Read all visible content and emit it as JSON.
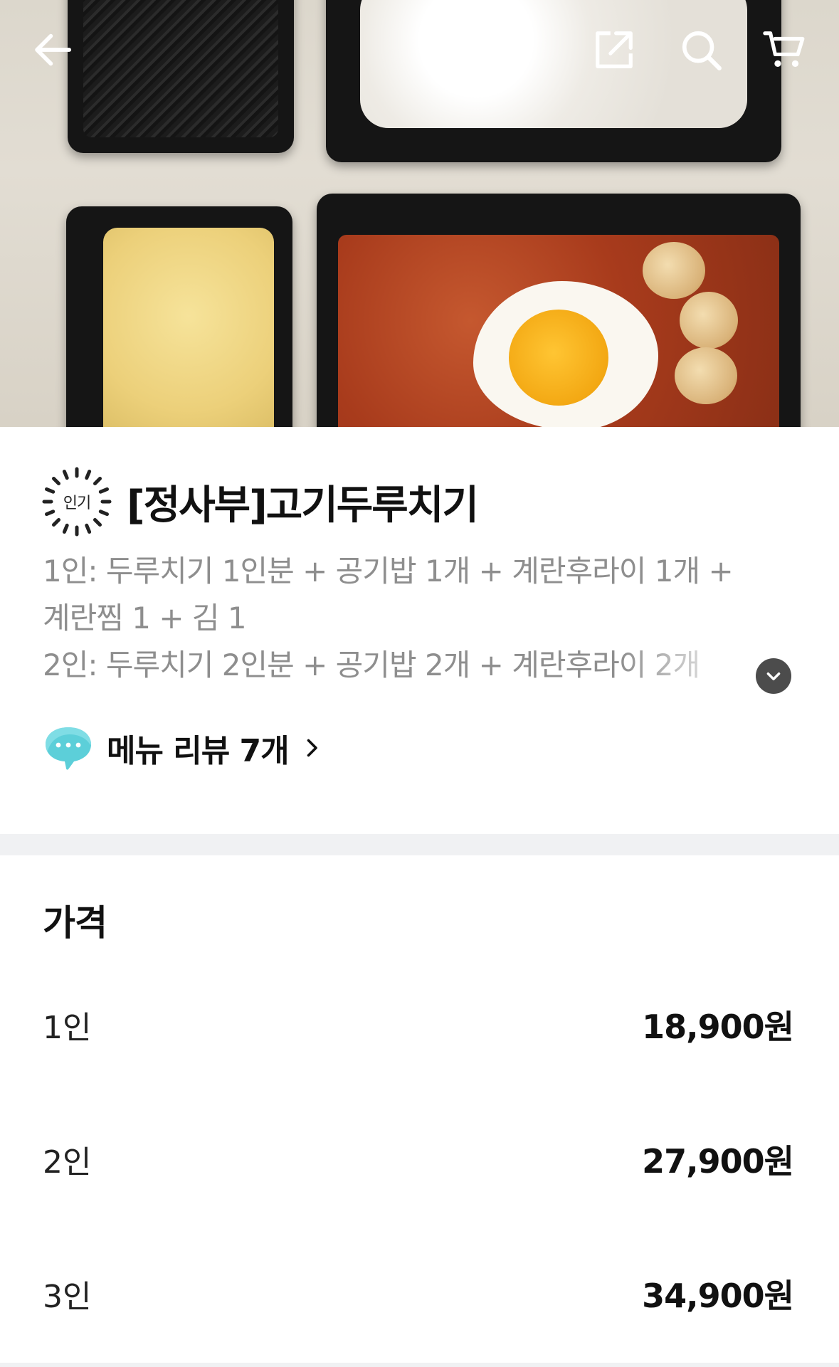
{
  "header": {
    "back_icon": "arrow-left-icon",
    "share_icon": "share-icon",
    "search_icon": "search-icon",
    "cart_icon": "cart-icon",
    "icon_color": "#ffffff"
  },
  "menu": {
    "badge": "인기",
    "title": "[정사부]고기두루치기",
    "description_lines": [
      "1인: 두루치기 1인분 + 공기밥 1개 + 계란후라이 1개 +",
      "계란찜 1 + 김 1",
      "2인: 두루치기 2인분 + 공기밥 2개 + 계란후라이 2개"
    ],
    "expand_icon": "chevron-down-icon",
    "review_link": "메뉴 리뷰 7개"
  },
  "price_section": {
    "heading": "가격",
    "rows": [
      {
        "label": "1인",
        "value": "18,900원"
      },
      {
        "label": "2인",
        "value": "27,900원"
      },
      {
        "label": "3인",
        "value": "34,900원"
      }
    ]
  },
  "colors": {
    "review_bubble": "#5ccfd9",
    "muted_text": "#8e8e8e",
    "section_divider": "#f0f1f3"
  }
}
